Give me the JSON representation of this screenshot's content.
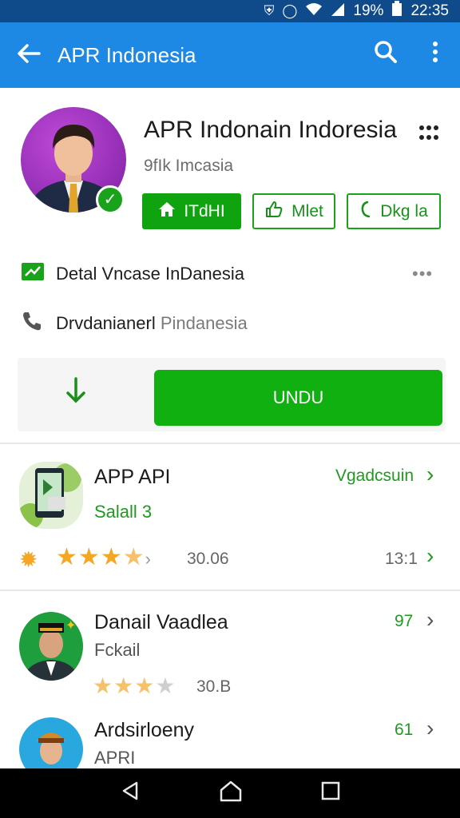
{
  "status_bar": {
    "icons": [
      "nfc-icon",
      "alarm-icon",
      "wifi-icon",
      "signal-icon"
    ],
    "battery": "19%",
    "time": "22:35"
  },
  "app_bar": {
    "title": "APR Indonesia"
  },
  "profile": {
    "name": "APR Indonain Indoresia",
    "subtitle": "9fIk Imcasia",
    "buttons": [
      "ITdHI",
      "Mlet",
      "Dkg la"
    ]
  },
  "info_rows": [
    {
      "text": "Detal Vncase InDanesia",
      "muted": ""
    },
    {
      "text": "Drvdanianerl ",
      "muted": "Pindanesia"
    }
  ],
  "download": {
    "label": "UNDU"
  },
  "apps": [
    {
      "title": "APP API",
      "sub": "Salall 3",
      "right": "Vgadcsuin",
      "rating": 3.5,
      "rating_text": "30.06",
      "count": "13:1"
    },
    {
      "title": "Danail Vaadlea",
      "sub": "Fckail",
      "right": "97",
      "rating": 3,
      "rating_text": "30.B"
    },
    {
      "title": "Ardsirloeny",
      "sub": "APRI",
      "right": "61"
    }
  ],
  "colors": {
    "app_bar": "#1e88e5",
    "status_bar": "#0f4a8a",
    "accent_green": "#10a310"
  }
}
